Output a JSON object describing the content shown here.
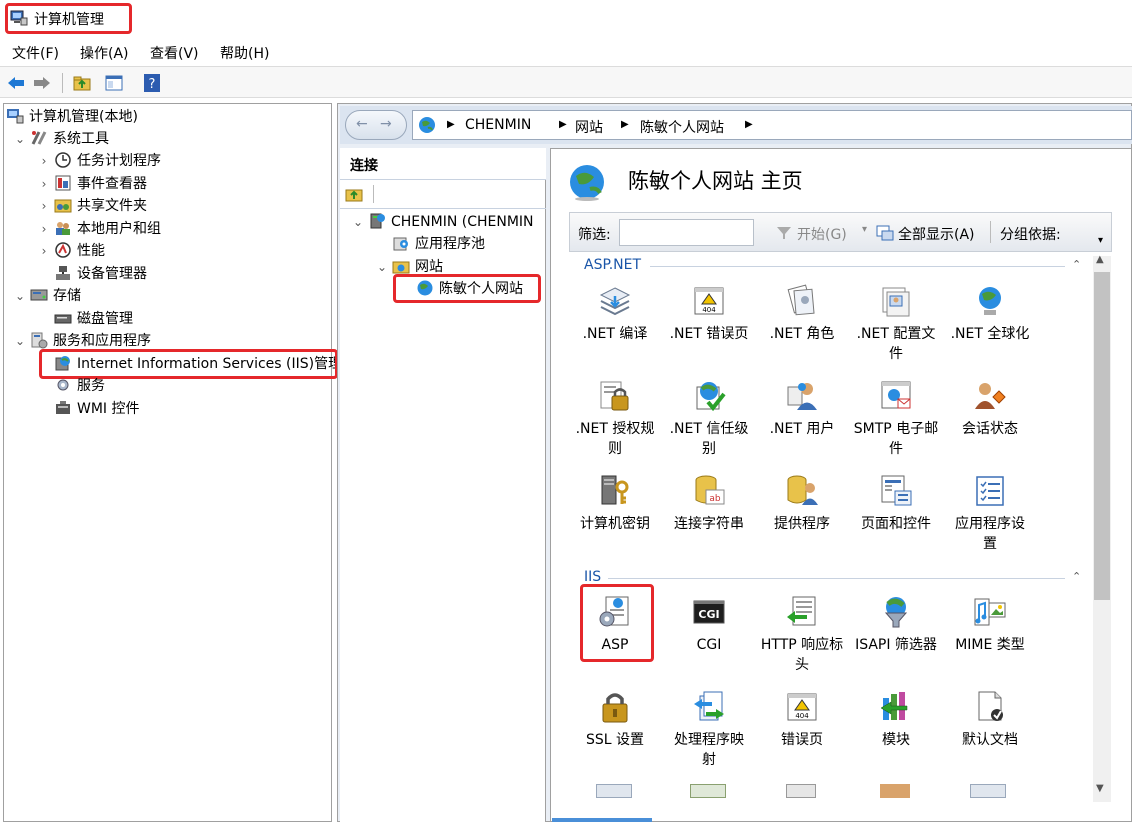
{
  "window": {
    "title": "计算机管理"
  },
  "menu": [
    "文件(F)",
    "操作(A)",
    "查看(V)",
    "帮助(H)"
  ],
  "tree": {
    "root": "计算机管理(本地)",
    "system_tools": "系统工具",
    "task_scheduler": "任务计划程序",
    "event_viewer": "事件查看器",
    "shared_folders": "共享文件夹",
    "local_users": "本地用户和组",
    "performance": "性能",
    "device_manager": "设备管理器",
    "storage": "存储",
    "disk_management": "磁盘管理",
    "services_apps": "服务和应用程序",
    "iis": "Internet Information Services (IIS)管理",
    "services": "服务",
    "wmi": "WMI 控件"
  },
  "breadcrumb": [
    "CHENMIN",
    "网站",
    "陈敏个人网站"
  ],
  "connections": {
    "header": "连接",
    "server": "CHENMIN (CHENMIN",
    "app_pools": "应用程序池",
    "sites": "网站",
    "site": "陈敏个人网站"
  },
  "main": {
    "title": "陈敏个人网站 主页",
    "filter_label": "筛选:",
    "start_label": "开始(G)",
    "show_all_label": "全部显示(A)",
    "group_by_label": "分组依据:"
  },
  "groups": {
    "aspnet": {
      "title": "ASP.NET",
      "features": [
        {
          "l1": ".NET 编译",
          "l2": "",
          "icon": "net-compile-icon"
        },
        {
          "l1": ".NET 错误页",
          "l2": "",
          "icon": "net-error-pages-icon"
        },
        {
          "l1": ".NET 角色",
          "l2": "",
          "icon": "net-roles-icon"
        },
        {
          "l1": ".NET 配置文",
          "l2": "件",
          "icon": "net-profile-icon"
        },
        {
          "l1": ".NET 全球化",
          "l2": "",
          "icon": "net-globalization-icon"
        },
        {
          "l1": ".NET 授权规",
          "l2": "则",
          "icon": "net-authorization-icon"
        },
        {
          "l1": ".NET 信任级",
          "l2": "别",
          "icon": "net-trust-levels-icon"
        },
        {
          "l1": ".NET 用户",
          "l2": "",
          "icon": "net-users-icon"
        },
        {
          "l1": "SMTP 电子邮",
          "l2": "件",
          "icon": "smtp-email-icon"
        },
        {
          "l1": "会话状态",
          "l2": "",
          "icon": "session-state-icon"
        },
        {
          "l1": "计算机密钥",
          "l2": "",
          "icon": "machine-key-icon"
        },
        {
          "l1": "连接字符串",
          "l2": "",
          "icon": "connection-strings-icon"
        },
        {
          "l1": "提供程序",
          "l2": "",
          "icon": "providers-icon"
        },
        {
          "l1": "页面和控件",
          "l2": "",
          "icon": "pages-controls-icon"
        },
        {
          "l1": "应用程序设",
          "l2": "置",
          "icon": "app-settings-icon"
        }
      ]
    },
    "iis": {
      "title": "IIS",
      "features": [
        {
          "l1": "ASP",
          "l2": "",
          "icon": "asp-icon"
        },
        {
          "l1": "CGI",
          "l2": "",
          "icon": "cgi-icon"
        },
        {
          "l1": "HTTP 响应标",
          "l2": "头",
          "icon": "http-headers-icon"
        },
        {
          "l1": "ISAPI 筛选器",
          "l2": "",
          "icon": "isapi-filters-icon"
        },
        {
          "l1": "MIME 类型",
          "l2": "",
          "icon": "mime-types-icon"
        },
        {
          "l1": "SSL 设置",
          "l2": "",
          "icon": "ssl-settings-icon"
        },
        {
          "l1": "处理程序映",
          "l2": "射",
          "icon": "handler-mappings-icon"
        },
        {
          "l1": "错误页",
          "l2": "",
          "icon": "error-pages-icon"
        },
        {
          "l1": "模块",
          "l2": "",
          "icon": "modules-icon"
        },
        {
          "l1": "默认文档",
          "l2": "",
          "icon": "default-document-icon"
        }
      ]
    }
  },
  "colors": {
    "highlight": "#e5282b",
    "group_title": "#1a55a8",
    "globe": "#2a8de0"
  }
}
